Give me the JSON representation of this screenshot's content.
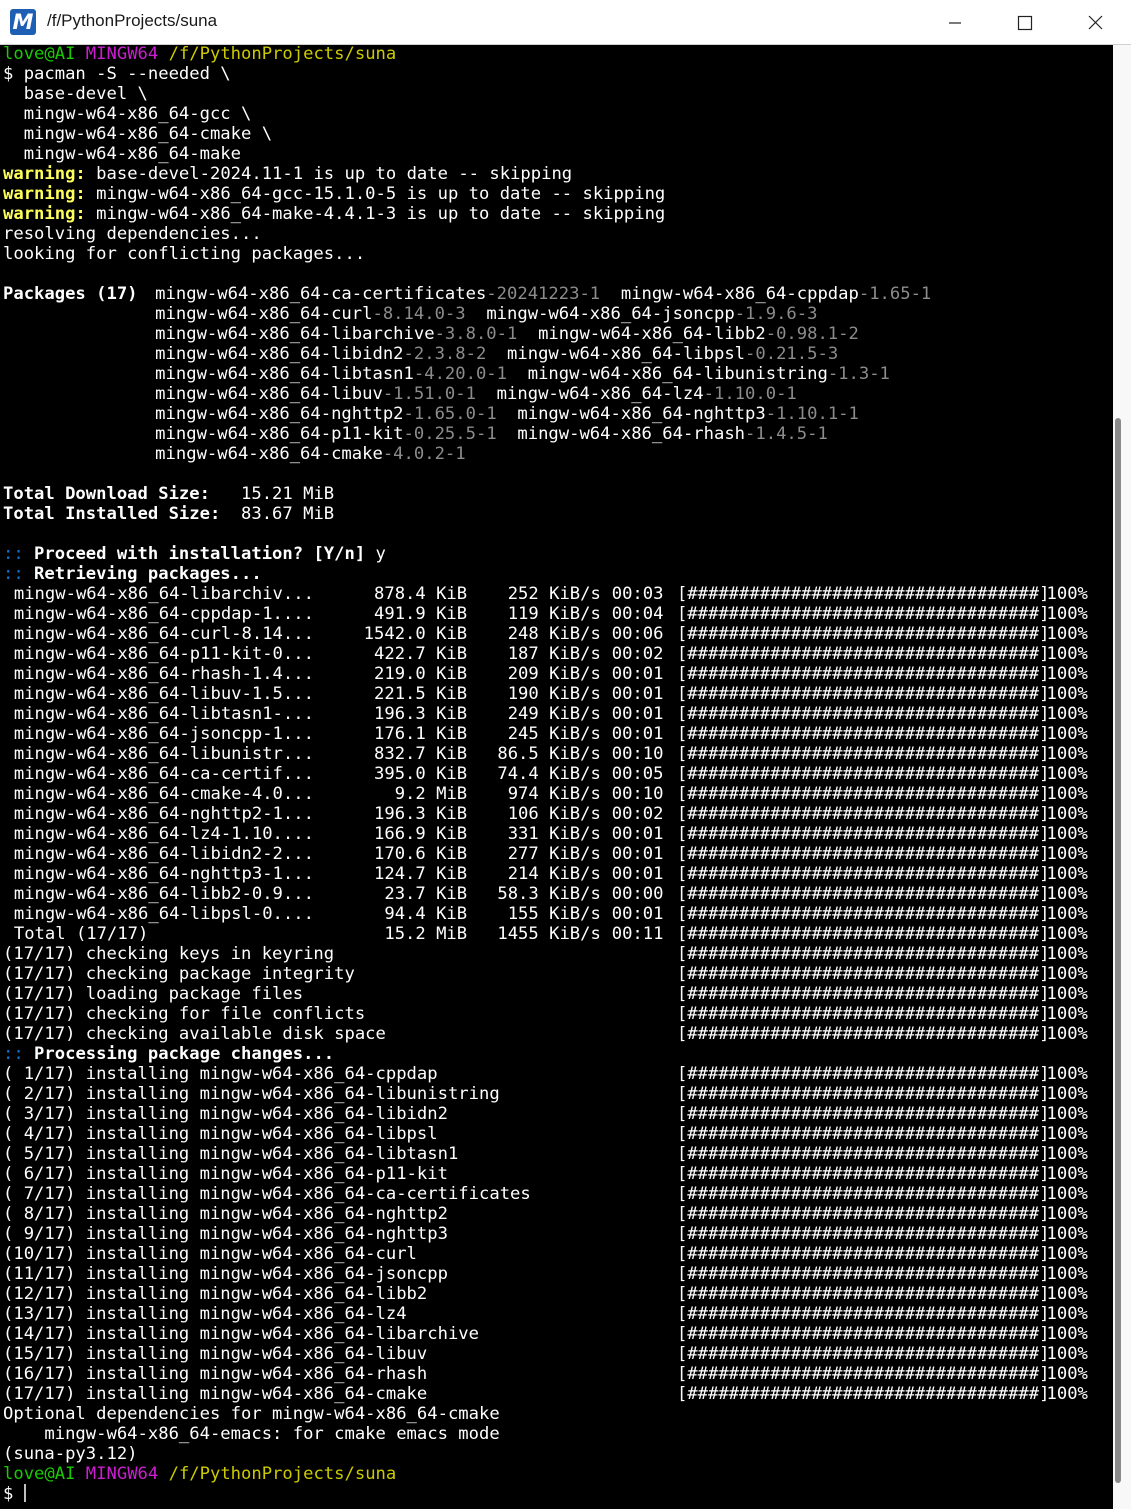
{
  "window": {
    "title": "/f/PythonProjects/suna",
    "icon": "msys2-icon",
    "controls": [
      "minimize",
      "maximize",
      "close"
    ]
  },
  "prompt": {
    "user": "love@AI",
    "system": "MINGW64",
    "path": "/f/PythonProjects/suna"
  },
  "command": [
    "$ pacman -S --needed \\",
    "  base-devel \\",
    "  mingw-w64-x86_64-gcc \\",
    "  mingw-w64-x86_64-cmake \\",
    "  mingw-w64-x86_64-make"
  ],
  "warnings": [
    {
      "label": "warning:",
      "text": " base-devel-2024.11-1 is up to date -- skipping"
    },
    {
      "label": "warning:",
      "text": " mingw-w64-x86_64-gcc-15.1.0-5 is up to date -- skipping"
    },
    {
      "label": "warning:",
      "text": " mingw-w64-x86_64-make-4.4.1-3 is up to date -- skipping"
    }
  ],
  "status_lines": [
    "resolving dependencies...",
    "looking for conflicting packages..."
  ],
  "packages_header": "Packages (17)",
  "packages": [
    {
      "name": "mingw-w64-x86_64-ca-certificates",
      "ver": "-20241223-1"
    },
    {
      "name": "mingw-w64-x86_64-cppdap",
      "ver": "-1.65-1"
    },
    {
      "name": "mingw-w64-x86_64-curl",
      "ver": "-8.14.0-3"
    },
    {
      "name": "mingw-w64-x86_64-jsoncpp",
      "ver": "-1.9.6-3"
    },
    {
      "name": "mingw-w64-x86_64-libarchive",
      "ver": "-3.8.0-1"
    },
    {
      "name": "mingw-w64-x86_64-libb2",
      "ver": "-0.98.1-2"
    },
    {
      "name": "mingw-w64-x86_64-libidn2",
      "ver": "-2.3.8-2"
    },
    {
      "name": "mingw-w64-x86_64-libpsl",
      "ver": "-0.21.5-3"
    },
    {
      "name": "mingw-w64-x86_64-libtasn1",
      "ver": "-4.20.0-1"
    },
    {
      "name": "mingw-w64-x86_64-libunistring",
      "ver": "-1.3-1"
    },
    {
      "name": "mingw-w64-x86_64-libuv",
      "ver": "-1.51.0-1"
    },
    {
      "name": "mingw-w64-x86_64-lz4",
      "ver": "-1.10.0-1"
    },
    {
      "name": "mingw-w64-x86_64-nghttp2",
      "ver": "-1.65.0-1"
    },
    {
      "name": "mingw-w64-x86_64-nghttp3",
      "ver": "-1.10.1-1"
    },
    {
      "name": "mingw-w64-x86_64-p11-kit",
      "ver": "-0.25.5-1"
    },
    {
      "name": "mingw-w64-x86_64-rhash",
      "ver": "-1.4.5-1"
    },
    {
      "name": "mingw-w64-x86_64-cmake",
      "ver": "-4.0.2-1"
    }
  ],
  "sizes": [
    {
      "label": "Total Download Size:",
      "value": "   15.21 MiB"
    },
    {
      "label": "Total Installed Size:",
      "value": "  83.67 MiB"
    }
  ],
  "proceed": {
    "marker": "::",
    "question": " Proceed with installation? [Y/n]",
    "answer": " y"
  },
  "retrieving": {
    "marker": "::",
    "text": " Retrieving packages..."
  },
  "progress_bar": "[##################################]",
  "downloads": [
    {
      "name": "mingw-w64-x86_64-libarchiv...",
      "size": "878.4 KiB",
      "speed": "252 KiB/s",
      "time": "00:03",
      "pct": "100%"
    },
    {
      "name": "mingw-w64-x86_64-cppdap-1....",
      "size": "491.9 KiB",
      "speed": "119 KiB/s",
      "time": "00:04",
      "pct": "100%"
    },
    {
      "name": "mingw-w64-x86_64-curl-8.14...",
      "size": "1542.0 KiB",
      "speed": "248 KiB/s",
      "time": "00:06",
      "pct": "100%"
    },
    {
      "name": "mingw-w64-x86_64-p11-kit-0...",
      "size": "422.7 KiB",
      "speed": "187 KiB/s",
      "time": "00:02",
      "pct": "100%"
    },
    {
      "name": "mingw-w64-x86_64-rhash-1.4...",
      "size": "219.0 KiB",
      "speed": "209 KiB/s",
      "time": "00:01",
      "pct": "100%"
    },
    {
      "name": "mingw-w64-x86_64-libuv-1.5...",
      "size": "221.5 KiB",
      "speed": "190 KiB/s",
      "time": "00:01",
      "pct": "100%"
    },
    {
      "name": "mingw-w64-x86_64-libtasn1-...",
      "size": "196.3 KiB",
      "speed": "249 KiB/s",
      "time": "00:01",
      "pct": "100%"
    },
    {
      "name": "mingw-w64-x86_64-jsoncpp-1...",
      "size": "176.1 KiB",
      "speed": "245 KiB/s",
      "time": "00:01",
      "pct": "100%"
    },
    {
      "name": "mingw-w64-x86_64-libunistr...",
      "size": "832.7 KiB",
      "speed": "86.5 KiB/s",
      "time": "00:10",
      "pct": "100%"
    },
    {
      "name": "mingw-w64-x86_64-ca-certif...",
      "size": "395.0 KiB",
      "speed": "74.4 KiB/s",
      "time": "00:05",
      "pct": "100%"
    },
    {
      "name": "mingw-w64-x86_64-cmake-4.0...",
      "size": "9.2 MiB",
      "speed": "974 KiB/s",
      "time": "00:10",
      "pct": "100%"
    },
    {
      "name": "mingw-w64-x86_64-nghttp2-1...",
      "size": "196.3 KiB",
      "speed": "106 KiB/s",
      "time": "00:02",
      "pct": "100%"
    },
    {
      "name": "mingw-w64-x86_64-lz4-1.10....",
      "size": "166.9 KiB",
      "speed": "331 KiB/s",
      "time": "00:01",
      "pct": "100%"
    },
    {
      "name": "mingw-w64-x86_64-libidn2-2...",
      "size": "170.6 KiB",
      "speed": "277 KiB/s",
      "time": "00:01",
      "pct": "100%"
    },
    {
      "name": "mingw-w64-x86_64-nghttp3-1...",
      "size": "124.7 KiB",
      "speed": "214 KiB/s",
      "time": "00:01",
      "pct": "100%"
    },
    {
      "name": "mingw-w64-x86_64-libb2-0.9...",
      "size": "23.7 KiB",
      "speed": "58.3 KiB/s",
      "time": "00:00",
      "pct": "100%"
    },
    {
      "name": "mingw-w64-x86_64-libpsl-0....",
      "size": "94.4 KiB",
      "speed": "155 KiB/s",
      "time": "00:01",
      "pct": "100%"
    },
    {
      "name": "Total (17/17)",
      "size": "15.2 MiB",
      "speed": "1455 KiB/s",
      "time": "00:11",
      "pct": "100%"
    }
  ],
  "checks": [
    {
      "text": "(17/17) checking keys in keyring",
      "pct": "100%"
    },
    {
      "text": "(17/17) checking package integrity",
      "pct": "100%"
    },
    {
      "text": "(17/17) loading package files",
      "pct": "100%"
    },
    {
      "text": "(17/17) checking for file conflicts",
      "pct": "100%"
    },
    {
      "text": "(17/17) checking available disk space",
      "pct": "100%"
    }
  ],
  "processing": {
    "marker": "::",
    "text": " Processing package changes..."
  },
  "installs": [
    {
      "text": "( 1/17) installing mingw-w64-x86_64-cppdap",
      "pct": "100%"
    },
    {
      "text": "( 2/17) installing mingw-w64-x86_64-libunistring",
      "pct": "100%"
    },
    {
      "text": "( 3/17) installing mingw-w64-x86_64-libidn2",
      "pct": "100%"
    },
    {
      "text": "( 4/17) installing mingw-w64-x86_64-libpsl",
      "pct": "100%"
    },
    {
      "text": "( 5/17) installing mingw-w64-x86_64-libtasn1",
      "pct": "100%"
    },
    {
      "text": "( 6/17) installing mingw-w64-x86_64-p11-kit",
      "pct": "100%"
    },
    {
      "text": "( 7/17) installing mingw-w64-x86_64-ca-certificates",
      "pct": "100%"
    },
    {
      "text": "( 8/17) installing mingw-w64-x86_64-nghttp2",
      "pct": "100%"
    },
    {
      "text": "( 9/17) installing mingw-w64-x86_64-nghttp3",
      "pct": "100%"
    },
    {
      "text": "(10/17) installing mingw-w64-x86_64-curl",
      "pct": "100%"
    },
    {
      "text": "(11/17) installing mingw-w64-x86_64-jsoncpp",
      "pct": "100%"
    },
    {
      "text": "(12/17) installing mingw-w64-x86_64-libb2",
      "pct": "100%"
    },
    {
      "text": "(13/17) installing mingw-w64-x86_64-lz4",
      "pct": "100%"
    },
    {
      "text": "(14/17) installing mingw-w64-x86_64-libarchive",
      "pct": "100%"
    },
    {
      "text": "(15/17) installing mingw-w64-x86_64-libuv",
      "pct": "100%"
    },
    {
      "text": "(16/17) installing mingw-w64-x86_64-rhash",
      "pct": "100%"
    },
    {
      "text": "(17/17) installing mingw-w64-x86_64-cmake",
      "pct": "100%"
    }
  ],
  "optional": [
    "Optional dependencies for mingw-w64-x86_64-cmake",
    "    mingw-w64-x86_64-emacs: for cmake emacs mode"
  ],
  "env_line": "(suna-py3.12)",
  "final_prompt": "$ ",
  "colors": {
    "background": "#000000",
    "text": "#c0c0c0",
    "prompt_user": "#19cb00",
    "prompt_system": "#cb1ed1",
    "prompt_path": "#cdcb00",
    "warning": "#ffff5b",
    "marker": "#0d73cc",
    "version": "#8c8c8c"
  }
}
